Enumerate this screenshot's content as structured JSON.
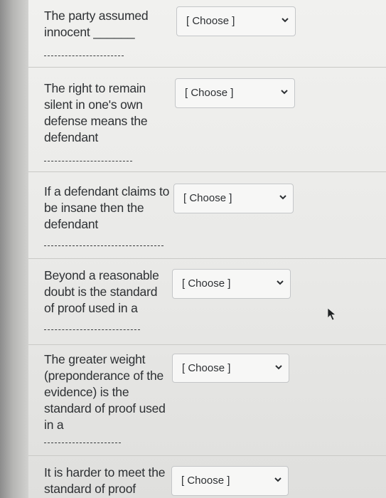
{
  "questions": [
    {
      "text": "The party assumed innocent",
      "inline_blank": "______",
      "select_label": "[ Choose ]"
    },
    {
      "text": "The right to remain silent in one's own defense means the defendant",
      "select_label": "[ Choose ]"
    },
    {
      "text": "If a defendant claims to be insane then the defendant",
      "select_label": "[ Choose ]"
    },
    {
      "text": "Beyond a reasonable doubt is the standard of proof used in a",
      "select_label": "[ Choose ]"
    },
    {
      "text": "The greater weight (preponderance of the evidence) is the standard of proof used in a",
      "select_label": "[ Choose ]"
    },
    {
      "text": "It is harder to meet the standard of proof",
      "select_label": "[ Choose ]"
    }
  ],
  "icons": {
    "dropdown": "chevron-down-icon",
    "cursor": "mouse-pointer-icon"
  }
}
